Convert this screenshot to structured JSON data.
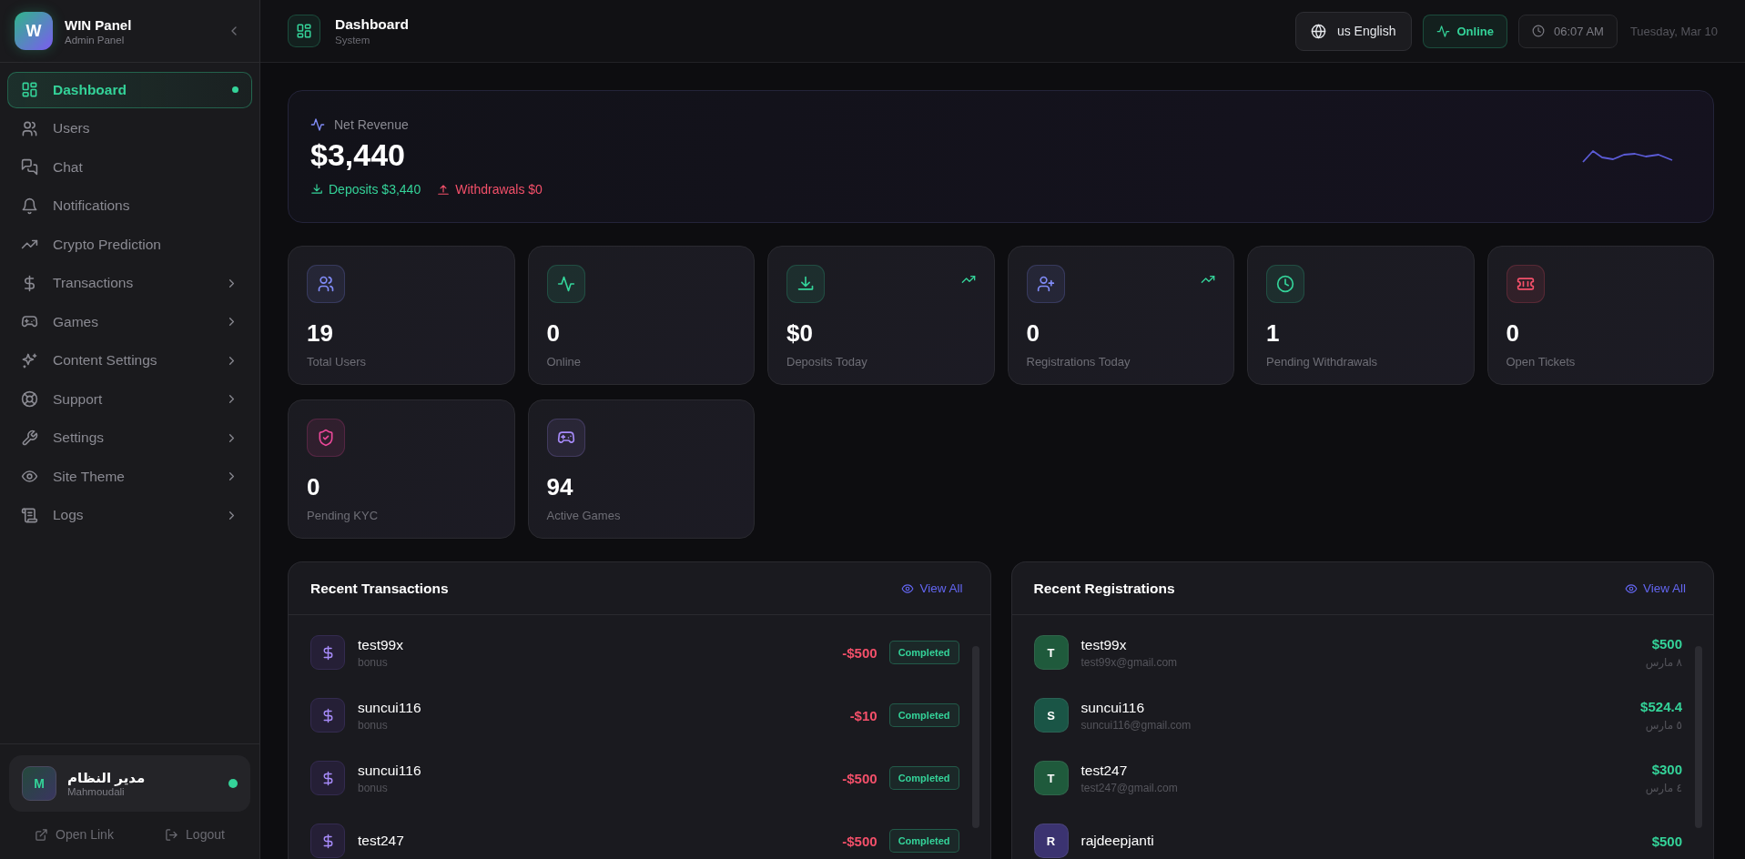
{
  "brand": {
    "logo_letter": "W",
    "title": "WIN Panel",
    "subtitle": "Admin Panel"
  },
  "nav": {
    "items": [
      {
        "label": "Dashboard",
        "selected": true,
        "has_submenu": false
      },
      {
        "label": "Users",
        "selected": false,
        "has_submenu": false
      },
      {
        "label": "Chat",
        "selected": false,
        "has_submenu": false
      },
      {
        "label": "Notifications",
        "selected": false,
        "has_submenu": false
      },
      {
        "label": "Crypto Prediction",
        "selected": false,
        "has_submenu": false
      },
      {
        "label": "Transactions",
        "selected": false,
        "has_submenu": true
      },
      {
        "label": "Games",
        "selected": false,
        "has_submenu": true
      },
      {
        "label": "Content Settings",
        "selected": false,
        "has_submenu": true
      },
      {
        "label": "Support",
        "selected": false,
        "has_submenu": true
      },
      {
        "label": "Settings",
        "selected": false,
        "has_submenu": true
      },
      {
        "label": "Site Theme",
        "selected": false,
        "has_submenu": true
      },
      {
        "label": "Logs",
        "selected": false,
        "has_submenu": true
      }
    ]
  },
  "user": {
    "initial": "M",
    "name": "مدير النظام",
    "handle": "Mahmoudali",
    "online": true
  },
  "footer_links": [
    "Open Link",
    "Logout"
  ],
  "header": {
    "title": "Dashboard",
    "subtitle": "System",
    "language": "us English",
    "status": "Online",
    "time": "06:07 AM",
    "date": "Tuesday, Mar 10"
  },
  "revenue": {
    "label": "Net Revenue",
    "value": "$3,440",
    "deposits": "Deposits $3,440",
    "withdrawals": "Withdrawals $0"
  },
  "stats": [
    {
      "value": "19",
      "label": "Total Users",
      "color": "#818cf8",
      "trend": false
    },
    {
      "value": "0",
      "label": "Online",
      "color": "#34d399",
      "trend": false
    },
    {
      "value": "$0",
      "label": "Deposits Today",
      "color": "#34d399",
      "trend": true
    },
    {
      "value": "0",
      "label": "Registrations Today",
      "color": "#818cf8",
      "trend": true
    },
    {
      "value": "1",
      "label": "Pending Withdrawals",
      "color": "#34d399",
      "trend": false
    },
    {
      "value": "0",
      "label": "Open Tickets",
      "color": "#f4506a",
      "trend": false
    },
    {
      "value": "0",
      "label": "Pending KYC",
      "color": "#ec4899",
      "trend": false
    },
    {
      "value": "94",
      "label": "Active Games",
      "color": "#a78bfa",
      "trend": false
    }
  ],
  "transactions": {
    "title": "Recent Transactions",
    "view_all": "View All",
    "rows": [
      {
        "name": "test99x",
        "type": "bonus",
        "amount": "-$500",
        "status": "Completed"
      },
      {
        "name": "suncui116",
        "type": "bonus",
        "amount": "-$10",
        "status": "Completed"
      },
      {
        "name": "suncui116",
        "type": "bonus",
        "amount": "-$500",
        "status": "Completed"
      },
      {
        "name": "test247",
        "amount": "-$500",
        "status": "Completed"
      }
    ]
  },
  "registrations": {
    "title": "Recent Registrations",
    "view_all": "View All",
    "rows": [
      {
        "initial": "T",
        "name": "test99x",
        "email": "test99x@gmail.com",
        "amount": "$500",
        "date": "٨ مارس",
        "color": "#1f5a3c"
      },
      {
        "initial": "S",
        "name": "suncui116",
        "email": "suncui116@gmail.com",
        "amount": "$524.4",
        "date": "٥ مارس",
        "color": "#1a5546"
      },
      {
        "initial": "T",
        "name": "test247",
        "email": "test247@gmail.com",
        "amount": "$300",
        "date": "٤ مارس",
        "color": "#1f5a3c"
      },
      {
        "initial": "R",
        "name": "rajdeepjanti",
        "amount": "$500",
        "color": "#3b3370"
      }
    ]
  }
}
